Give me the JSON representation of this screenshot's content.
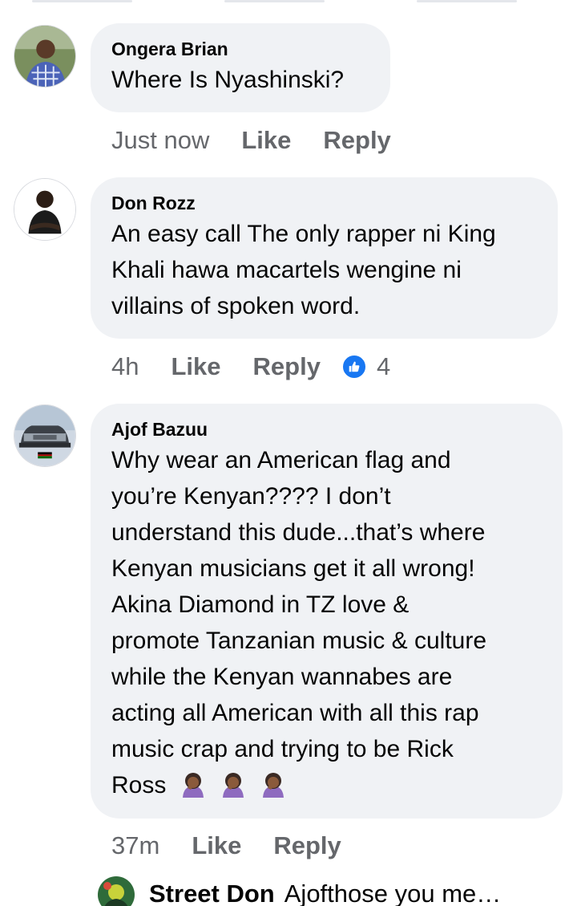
{
  "comments": [
    {
      "author": "Ongera Brian",
      "text": "Where Is Nyashinski?",
      "time": "Just now",
      "like_label": "Like",
      "reply_label": "Reply",
      "avatar_icon": "profile-photo"
    },
    {
      "author": "Don Rozz",
      "text_lines": [
        "An easy call The only rapper ni King",
        "Khali hawa macartels wengine ni",
        "villains of spoken word."
      ],
      "time": "4h",
      "like_label": "Like",
      "reply_label": "Reply",
      "reaction_icon": "thumbs-up-icon",
      "reaction_count": "4",
      "avatar_icon": "profile-photo"
    },
    {
      "author": "Ajof Bazuu",
      "text_lines": [
        "Why wear an American flag and",
        "you’re Kenyan???? I don’t",
        "understand this dude...that’s where",
        "Kenyan musicians get it all wrong!",
        "Akina Diamond in TZ love &",
        "promote Tanzanian music & culture",
        "while the Kenyan wannabes are",
        "acting all American with all this rap",
        "music crap and trying to be Rick",
        "Ross"
      ],
      "emojis": [
        "woman-facepalming",
        "woman-facepalming",
        "woman-facepalming"
      ],
      "time": "37m",
      "like_label": "Like",
      "reply_label": "Reply",
      "avatar_icon": "profile-photo-car-flag"
    }
  ],
  "reply_preview": {
    "author": "Street Don",
    "text": "Ajofthose you  me…"
  },
  "colors": {
    "bubble": "#f0f2f5",
    "meta_text": "#65676b",
    "like_blue": "#1877f2"
  }
}
